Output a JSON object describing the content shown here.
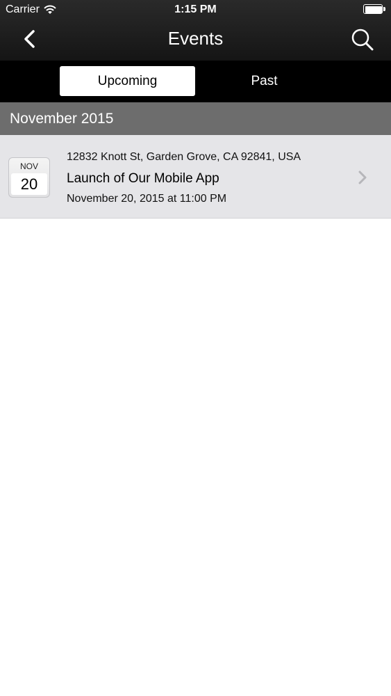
{
  "status_bar": {
    "carrier": "Carrier",
    "time": "1:15 PM",
    "icons": [
      "wifi-icon",
      "battery-icon"
    ]
  },
  "nav_bar": {
    "title": "Events",
    "back_icon": "chevron-left-icon",
    "search_icon": "search-icon"
  },
  "segments": {
    "upcoming": "Upcoming",
    "past": "Past",
    "selected": "Upcoming"
  },
  "sections": [
    {
      "header": "November 2015",
      "events": [
        {
          "month": "NOV",
          "day": "20",
          "address": "12832 Knott St, Garden Grove, CA 92841, USA",
          "title": "Launch of Our Mobile App",
          "datetime": "November 20, 2015 at 11:00 PM"
        }
      ]
    }
  ],
  "colors": {
    "nav_background": "#1e1e1e",
    "segment_background": "#000000",
    "section_header": "#6d6d6d",
    "row_background": "#e5e5e8"
  }
}
